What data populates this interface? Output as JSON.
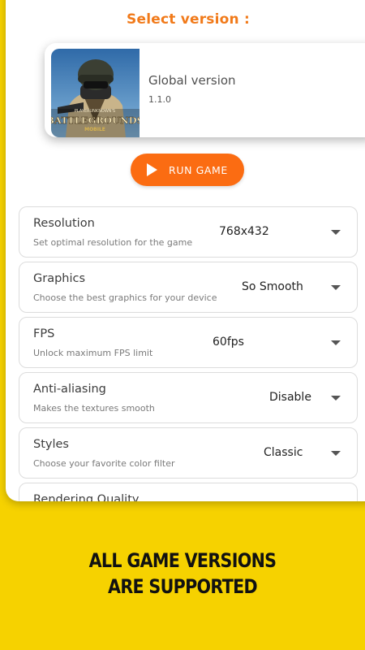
{
  "header": {
    "title": "Select version :"
  },
  "version_card": {
    "name": "Global version",
    "number": "1.1.0",
    "art_text_top": "PLAYERUNKNOWN'S",
    "art_text_main": "BATTLEGROUNDS",
    "art_text_sub": "MOBILE"
  },
  "run_button": {
    "label": "RUN GAME",
    "icon": "play-icon",
    "color": "#fb6c12"
  },
  "settings": [
    {
      "name": "Resolution",
      "description": "Set optimal resolution for the game",
      "value": "768x432"
    },
    {
      "name": "Graphics",
      "description": "Choose the best graphics for your device",
      "value": "So Smooth"
    },
    {
      "name": "FPS",
      "description": "Unlock maximum FPS limit",
      "value": "60fps"
    },
    {
      "name": "Anti-aliasing",
      "description": "Makes the textures smooth",
      "value": "Disable"
    },
    {
      "name": "Styles",
      "description": "Choose your favorite color filter",
      "value": "Classic"
    },
    {
      "name": "Rendering Quality"
    }
  ],
  "promo": {
    "line1": "ALL GAME VERSIONS",
    "line2": "ARE SUPPORTED"
  },
  "colors": {
    "background": "#f6d200",
    "accent": "#f17a1a",
    "button": "#fb6c12"
  }
}
